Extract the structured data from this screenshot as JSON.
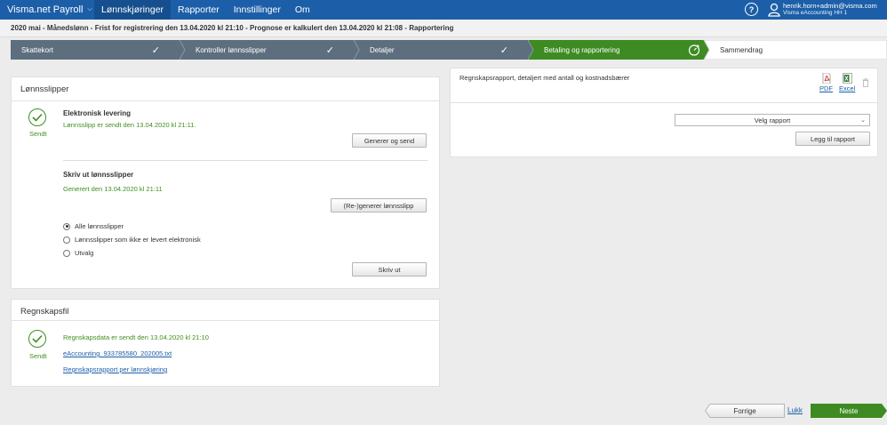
{
  "topnav": {
    "brand": "Visma.net Payroll",
    "menu": [
      {
        "label": "Lønnskjøringer",
        "active": true
      },
      {
        "label": "Rapporter",
        "active": false
      },
      {
        "label": "Innstillinger",
        "active": false
      },
      {
        "label": "Om",
        "active": false
      }
    ],
    "help": "?",
    "user_email": "henrik.horn+admin@visma.com",
    "user_company": "Visma eAccounting HH 1"
  },
  "subheader": "2020 mai - Månedslønn - Frist for registrering den 13.04.2020 kl 21:10 - Prognose er kalkulert den 13.04.2020 kl 21:08 - Rapportering",
  "wizard": {
    "steps": [
      {
        "label": "Skattekort",
        "done": true
      },
      {
        "label": "Kontroller lønnsslipper",
        "done": true
      },
      {
        "label": "Detaljer",
        "done": true
      },
      {
        "label": "Betaling og rapportering",
        "active": true
      },
      {
        "label": "Sammendrag",
        "done": false
      }
    ],
    "colors": {
      "done": "#5d6f7e",
      "active": "#3d8b22",
      "pending": "#ffffff"
    }
  },
  "lonnsslipper": {
    "title": "Lønnsslipper",
    "status": "Sendt",
    "electronic": {
      "title": "Elektronisk levering",
      "message": "Lønnsslipp er sendt den 13.04.2020 kl 21:11.",
      "button": "Generer og send"
    },
    "print": {
      "title": "Skriv ut lønnsslipper",
      "message": "Generert den 13.04.2020 kl 21:11",
      "regen_button": "(Re-)generer lønnsslipp",
      "options": [
        {
          "label": "Alle lønnsslipper",
          "selected": true
        },
        {
          "label": "Lønnsslipper som ikke er levert elektronisk",
          "selected": false
        },
        {
          "label": "Utvalg",
          "selected": false
        }
      ],
      "print_button": "Skriv ut"
    }
  },
  "regnskapsfil": {
    "title": "Regnskapsfil",
    "status": "Sendt",
    "message": "Regnskapsdata er sendt den 13.04.2020 kl 21:10",
    "file_link": "eAccounting_933785580_202005.txt",
    "report_link": "Regnskapsrapport per lønnskjøring"
  },
  "report_panel": {
    "title": "Regnskapsrapport, detaljert med antall og kostnadsbærer",
    "pdf_label": "PDF",
    "excel_label": "Excel",
    "select_placeholder": "Velg rapport",
    "add_button": "Legg til rapport"
  },
  "footer": {
    "back": "Forrige",
    "close": "Lukk",
    "next": "Neste"
  }
}
